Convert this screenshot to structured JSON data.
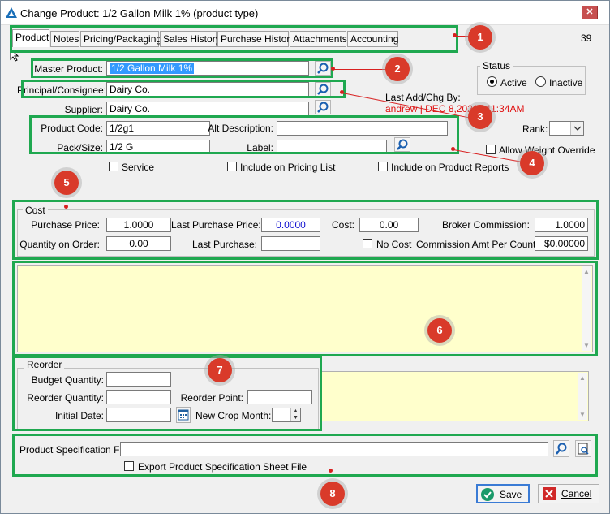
{
  "window": {
    "title": "Change Product: 1/2 Gallon Milk 1% (product type)",
    "close_glyph": "✕",
    "record_count": "39"
  },
  "tabs": [
    {
      "label": "Product",
      "active": true
    },
    {
      "label": "Notes"
    },
    {
      "label": "Pricing/Packaging"
    },
    {
      "label": "Sales History"
    },
    {
      "label": "Purchase History"
    },
    {
      "label": "Attachments"
    },
    {
      "label": "Accounting"
    }
  ],
  "product": {
    "master_product_label": "Master Product:",
    "master_product_value": "1/2 Gallon Milk 1%",
    "principal_label": "Principal/Consignee:",
    "principal_value": "Dairy Co.",
    "supplier_label": "Supplier:",
    "supplier_value": "Dairy Co.",
    "product_code_label": "Product Code:",
    "product_code_value": "1/2g1",
    "alt_description_label": "Alt Description:",
    "alt_description_value": "",
    "pack_size_label": "Pack/Size:",
    "pack_size_value": "1/2 G",
    "label_label": "Label:",
    "label_value": "",
    "service_label": "Service",
    "include_pricing_label": "Include on Pricing List",
    "include_reports_label": "Include on Product Reports"
  },
  "status": {
    "title": "Status",
    "active_label": "Active",
    "inactive_label": "Inactive",
    "selected": "Active",
    "last_change_label": "Last Add/Chg By:",
    "last_change_value": "andrew | DEC  8,2021 | 11:34AM",
    "rank_label": "Rank:",
    "allow_weight_override_label": "Allow Weight Override"
  },
  "cost": {
    "title": "Cost",
    "purchase_price_label": "Purchase Price:",
    "purchase_price_value": "1.0000",
    "last_purchase_price_label": "Last Purchase Price:",
    "last_purchase_price_value": "0.0000",
    "cost_label": "Cost:",
    "cost_value": "0.00",
    "broker_commission_label": "Broker Commission:",
    "broker_commission_value": "1.0000",
    "quantity_on_order_label": "Quantity on Order:",
    "quantity_on_order_value": "0.00",
    "last_purchase_label": "Last Purchase:",
    "last_purchase_value": "",
    "no_cost_label": "No Cost",
    "commission_per_count_label": "Commission Amt Per Count:",
    "commission_per_count_value": "$0.00000"
  },
  "reorder": {
    "title": "Reorder",
    "budget_quantity_label": "Budget Quantity:",
    "budget_quantity_value": "",
    "reorder_quantity_label": "Reorder Quantity:",
    "reorder_quantity_value": "",
    "reorder_point_label": "Reorder Point:",
    "reorder_point_value": "",
    "initial_date_label": "Initial Date:",
    "initial_date_value": "",
    "new_crop_month_label": "New Crop Month:",
    "new_crop_month_value": ""
  },
  "spec": {
    "file_label": "Product Specification File:",
    "file_value": "",
    "export_label": "Export Product Specification Sheet File"
  },
  "buttons": {
    "save": "Save",
    "cancel": "Cancel"
  },
  "badges": [
    "1",
    "2",
    "3",
    "4",
    "5",
    "6",
    "7",
    "8"
  ],
  "colors": {
    "highlight": "#1fa850",
    "badge": "#d93a2a",
    "notes_bg": "#ffffcc",
    "last_change_text": "#e01010",
    "selection": "#3399ff"
  }
}
